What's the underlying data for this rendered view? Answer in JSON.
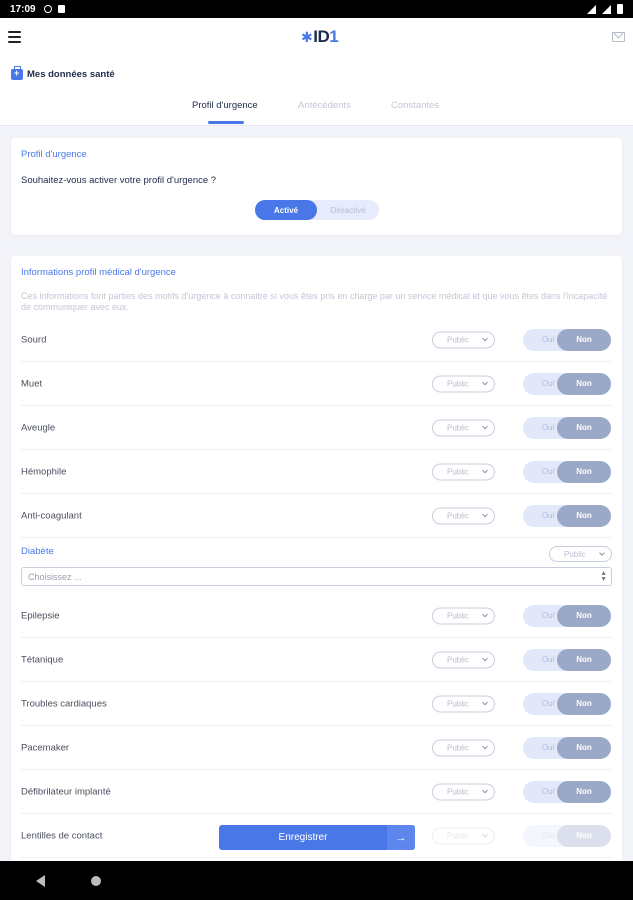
{
  "status_bar": {
    "time": "17:09"
  },
  "app": {
    "logo_text": "ID",
    "logo_accent": "1"
  },
  "header": {
    "section_title": "Mes données santé",
    "tabs": [
      {
        "label": "Profil d'urgence",
        "active": true
      },
      {
        "label": "Antécédents",
        "active": false
      },
      {
        "label": "Constantes",
        "active": false
      }
    ]
  },
  "emergency_profile": {
    "title": "Profil d'urgence",
    "question": "Souhaitez-vous activer votre profil d'urgence ?",
    "switch": {
      "on_label": "Activé",
      "off_label": "Désactivé",
      "value": "Activé"
    }
  },
  "medical_info": {
    "title": "Informations profil médical d'urgence",
    "description": "Ces informations font parties des motifs d'urgence à connaitre si vous êtes pris en charge par un service médical et que vous êtes dans l'incapacité de communiquer avec eux.",
    "visibility_label": "Public",
    "yes_label": "Oui",
    "no_label": "Non",
    "rows_top": [
      {
        "label": "Sourd",
        "visibility": "Public",
        "value": "Non"
      },
      {
        "label": "Muet",
        "visibility": "Public",
        "value": "Non"
      },
      {
        "label": "Aveugle",
        "visibility": "Public",
        "value": "Non"
      },
      {
        "label": "Hémophile",
        "visibility": "Public",
        "value": "Non"
      },
      {
        "label": "Anti-coagulant",
        "visibility": "Public",
        "value": "Non"
      }
    ],
    "diabetes": {
      "label": "Diabète",
      "visibility": "Public",
      "select_placeholder": "Choisissez ..."
    },
    "rows_bottom": [
      {
        "label": "Epilepsie",
        "visibility": "Public",
        "value": "Non"
      },
      {
        "label": "Tétanique",
        "visibility": "Public",
        "value": "Non"
      },
      {
        "label": "Troubles cardiaques",
        "visibility": "Public",
        "value": "Non"
      },
      {
        "label": "Pacemaker",
        "visibility": "Public",
        "value": "Non"
      },
      {
        "label": "Défibrilateur implanté",
        "visibility": "Public",
        "value": "Non"
      },
      {
        "label": "Lentilles de contact",
        "visibility": "Public",
        "value": "Non"
      }
    ]
  },
  "footer": {
    "save_label": "Enregistrer",
    "save_arrow": "→"
  },
  "colors": {
    "accent": "#4a77e8",
    "toggle_selected": "#9ba9c9",
    "toggle_track": "#e2e7fa",
    "background": "#f3f4f9"
  }
}
